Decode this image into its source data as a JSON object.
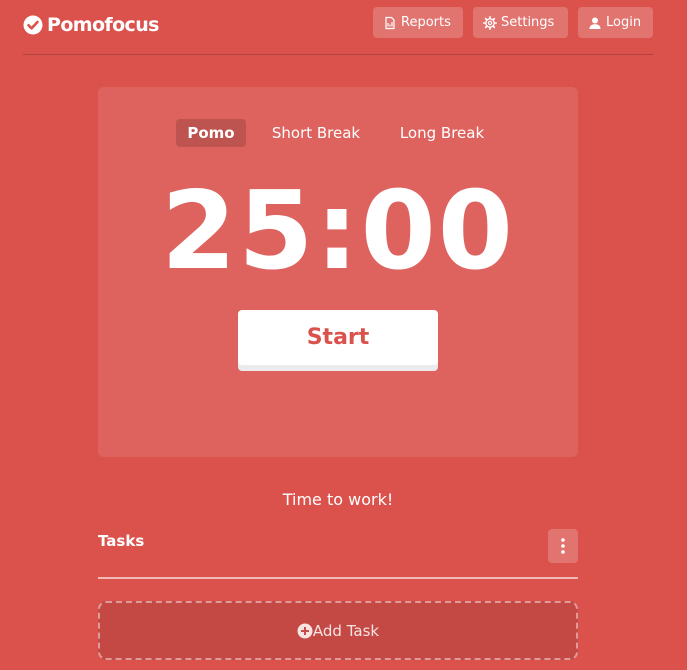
{
  "app": {
    "name": "Pomofocus",
    "theme_color": "#db524d",
    "logo_icon": "check-circle-icon"
  },
  "nav": {
    "reports": {
      "label": "Reports",
      "icon": "report-icon"
    },
    "settings": {
      "label": "Settings",
      "icon": "gear-icon"
    },
    "login": {
      "label": "Login",
      "icon": "user-icon"
    }
  },
  "timer": {
    "modes": [
      {
        "label": "Pomo",
        "active": true
      },
      {
        "label": "Short Break",
        "active": false
      },
      {
        "label": "Long Break",
        "active": false
      }
    ],
    "time": "25:00",
    "start_label": "Start"
  },
  "status": {
    "message": "Time to work!"
  },
  "tasks": {
    "title": "Tasks",
    "menu_icon": "vertical-dots-icon",
    "add_label": "Add Task",
    "add_icon": "plus-circle-icon"
  }
}
